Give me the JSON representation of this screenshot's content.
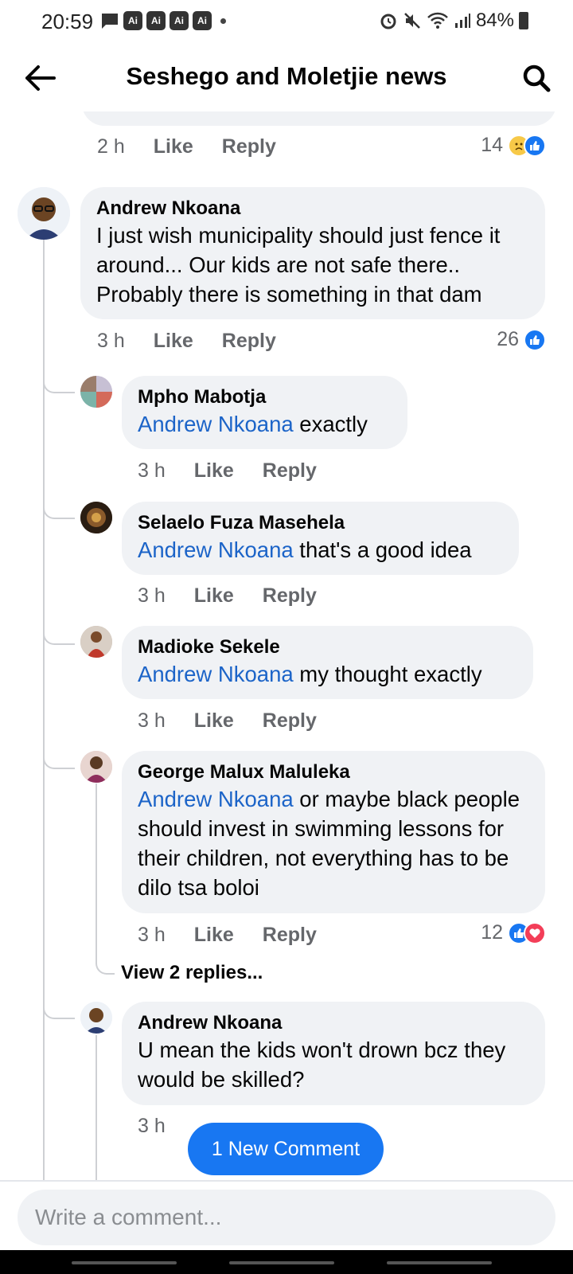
{
  "status_bar": {
    "time": "20:59",
    "ai_badges": [
      "Ai",
      "Ai",
      "Ai",
      "Ai"
    ],
    "battery": "84%"
  },
  "header": {
    "title": "Seshego and Moletjie news"
  },
  "prev_comment": {
    "time": "2 h",
    "like": "Like",
    "reply": "Reply",
    "reaction_count": "14"
  },
  "comments": [
    {
      "author": "Andrew Nkoana",
      "text": "I just wish municipality should just fence it around... Our kids are not safe there.. Probably there is something in that dam",
      "time": "3 h",
      "like": "Like",
      "reply": "Reply",
      "reaction_count": "26"
    }
  ],
  "replies": [
    {
      "author": "Mpho Mabotja",
      "mention": "Andrew Nkoana",
      "text": " exactly",
      "time": "3 h",
      "like": "Like",
      "reply": "Reply"
    },
    {
      "author": "Selaelo Fuza Masehela",
      "mention": "Andrew Nkoana",
      "text": " that's a good idea",
      "time": "3 h",
      "like": "Like",
      "reply": "Reply"
    },
    {
      "author": "Madioke Sekele",
      "mention": "Andrew Nkoana",
      "text": " my thought exactly",
      "time": "3 h",
      "like": "Like",
      "reply": "Reply"
    },
    {
      "author": "George Malux Maluleka",
      "mention": "Andrew Nkoana",
      "text": " or maybe black people should invest in swimming lessons for their children, not everything has to be dilo tsa boloi",
      "time": "3 h",
      "like": "Like",
      "reply": "Reply",
      "reaction_count": "12",
      "view_replies": "View 2 replies..."
    },
    {
      "author": "Andrew Nkoana",
      "text": "U mean the kids won't drown bcz they would be skilled?",
      "time": "3 h"
    }
  ],
  "new_comment_label": "1 New Comment",
  "composer": {
    "placeholder": "Write a comment..."
  },
  "colors": {
    "accent": "#1877f2",
    "mention": "#1c64c8",
    "bubble": "#f0f2f5",
    "muted": "#65676b"
  }
}
